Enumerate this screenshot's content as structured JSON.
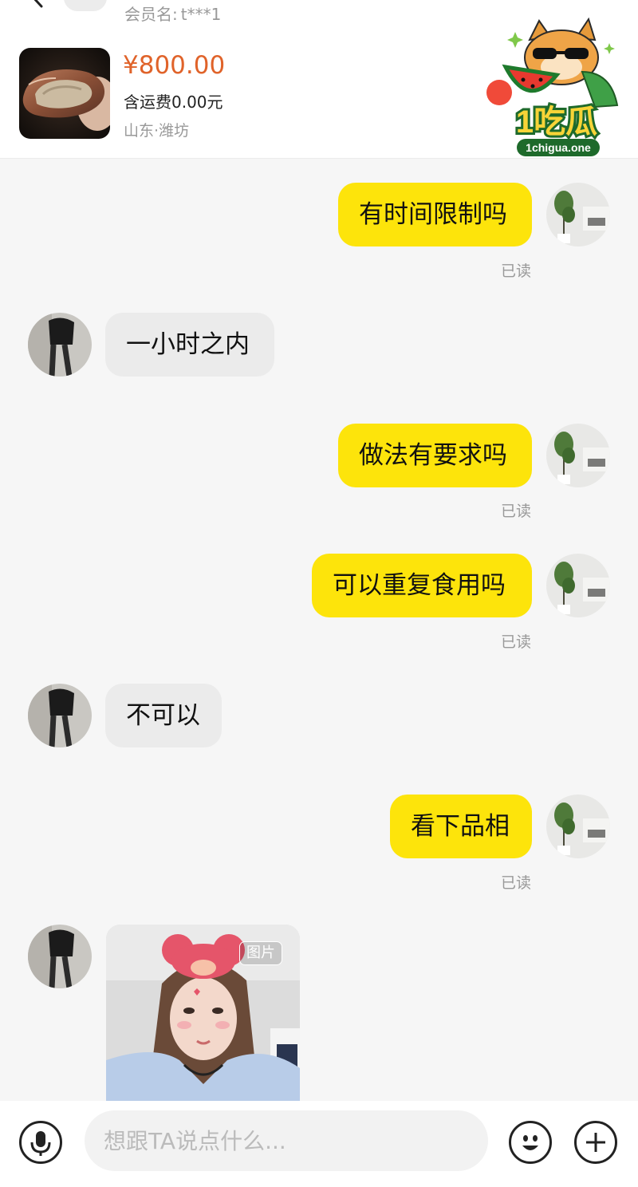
{
  "header": {
    "member_label": "会员名:",
    "member_name": "t***1",
    "price": "¥800.00",
    "shipping": "含运费0.00元",
    "location": "山东·潍坊"
  },
  "watermark": {
    "main": "1吃瓜",
    "url": "1chigua.one"
  },
  "messages": [
    {
      "from": "me",
      "text": "有时间限制吗",
      "status": "已读"
    },
    {
      "from": "them",
      "text": "一小时之内"
    },
    {
      "from": "me",
      "text": "做法有要求吗",
      "status": "已读"
    },
    {
      "from": "me",
      "text": "可以重复食用吗",
      "status": "已读"
    },
    {
      "from": "them",
      "text": "不可以"
    },
    {
      "from": "me",
      "text": "看下品相",
      "status": "已读"
    },
    {
      "from": "them",
      "type": "image",
      "tag": "图片"
    }
  ],
  "input": {
    "placeholder": "想跟TA说点什么..."
  },
  "icons": [
    "back-arrow-icon",
    "microphone-icon",
    "emoji-icon",
    "plus-icon"
  ],
  "colors": {
    "my_bubble": "#fde40b",
    "their_bubble": "#ebebeb",
    "price": "#e0632a"
  }
}
